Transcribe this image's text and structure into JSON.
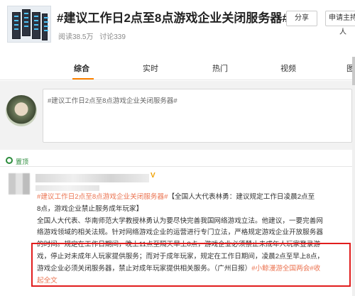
{
  "header": {
    "title": "#建议工作日2点至8点游戏企业关闭服务器#",
    "reads": "阅读38.5万",
    "discussions": "讨论339",
    "share_button": "分享",
    "host_button": "申请主持人"
  },
  "tabs": [
    {
      "label": "综合",
      "active": true
    },
    {
      "label": "实时",
      "active": false
    },
    {
      "label": "热门",
      "active": false
    },
    {
      "label": "视频",
      "active": false
    },
    {
      "label": "图",
      "active": false
    }
  ],
  "compose": {
    "text": "#建议工作日2点至8点游戏企业关闭服务器#"
  },
  "pinned": {
    "label": "置顶"
  },
  "post": {
    "verified_badge": "V",
    "line1_part1": "#建议工作日2点至8点游戏企业关闭服务器#",
    "line1_part2": "【全国人大代表林勇：建议规定工作日凌晨2点至",
    "line2": "8点，游戏企业禁止服务成年玩家】",
    "line3": "全国人大代表、华南师范大学教授林勇认为要尽快完善我国网络游戏立法。他建议，一要完善网",
    "line4": "络游戏领域的相关法规。针对网络游戏企业的运营进行专门立法，严格规定游戏企业开放服务器",
    "line5": "的时间。规定在工作日期间，晚上11点至隔天早上8点，游戏企业必须禁止未成年人玩家登录游",
    "line6": "戏，停止对未成年人玩家提供服务；而对于成年玩家，规定在工作日期间，凌晨2点至早上8点，",
    "line7_part1": "游戏企业必须关闭服务器，禁止对成年玩家提供相关服务。（广州日报）",
    "line7_link": "#小鲸漫游全国两会#",
    "line7_more": "收",
    "line8": "起全文"
  },
  "colors": {
    "accent": "#ff8200",
    "link": "#eb7350",
    "highlight_border": "#e11d1d",
    "pinned": "#2c8c3c"
  }
}
